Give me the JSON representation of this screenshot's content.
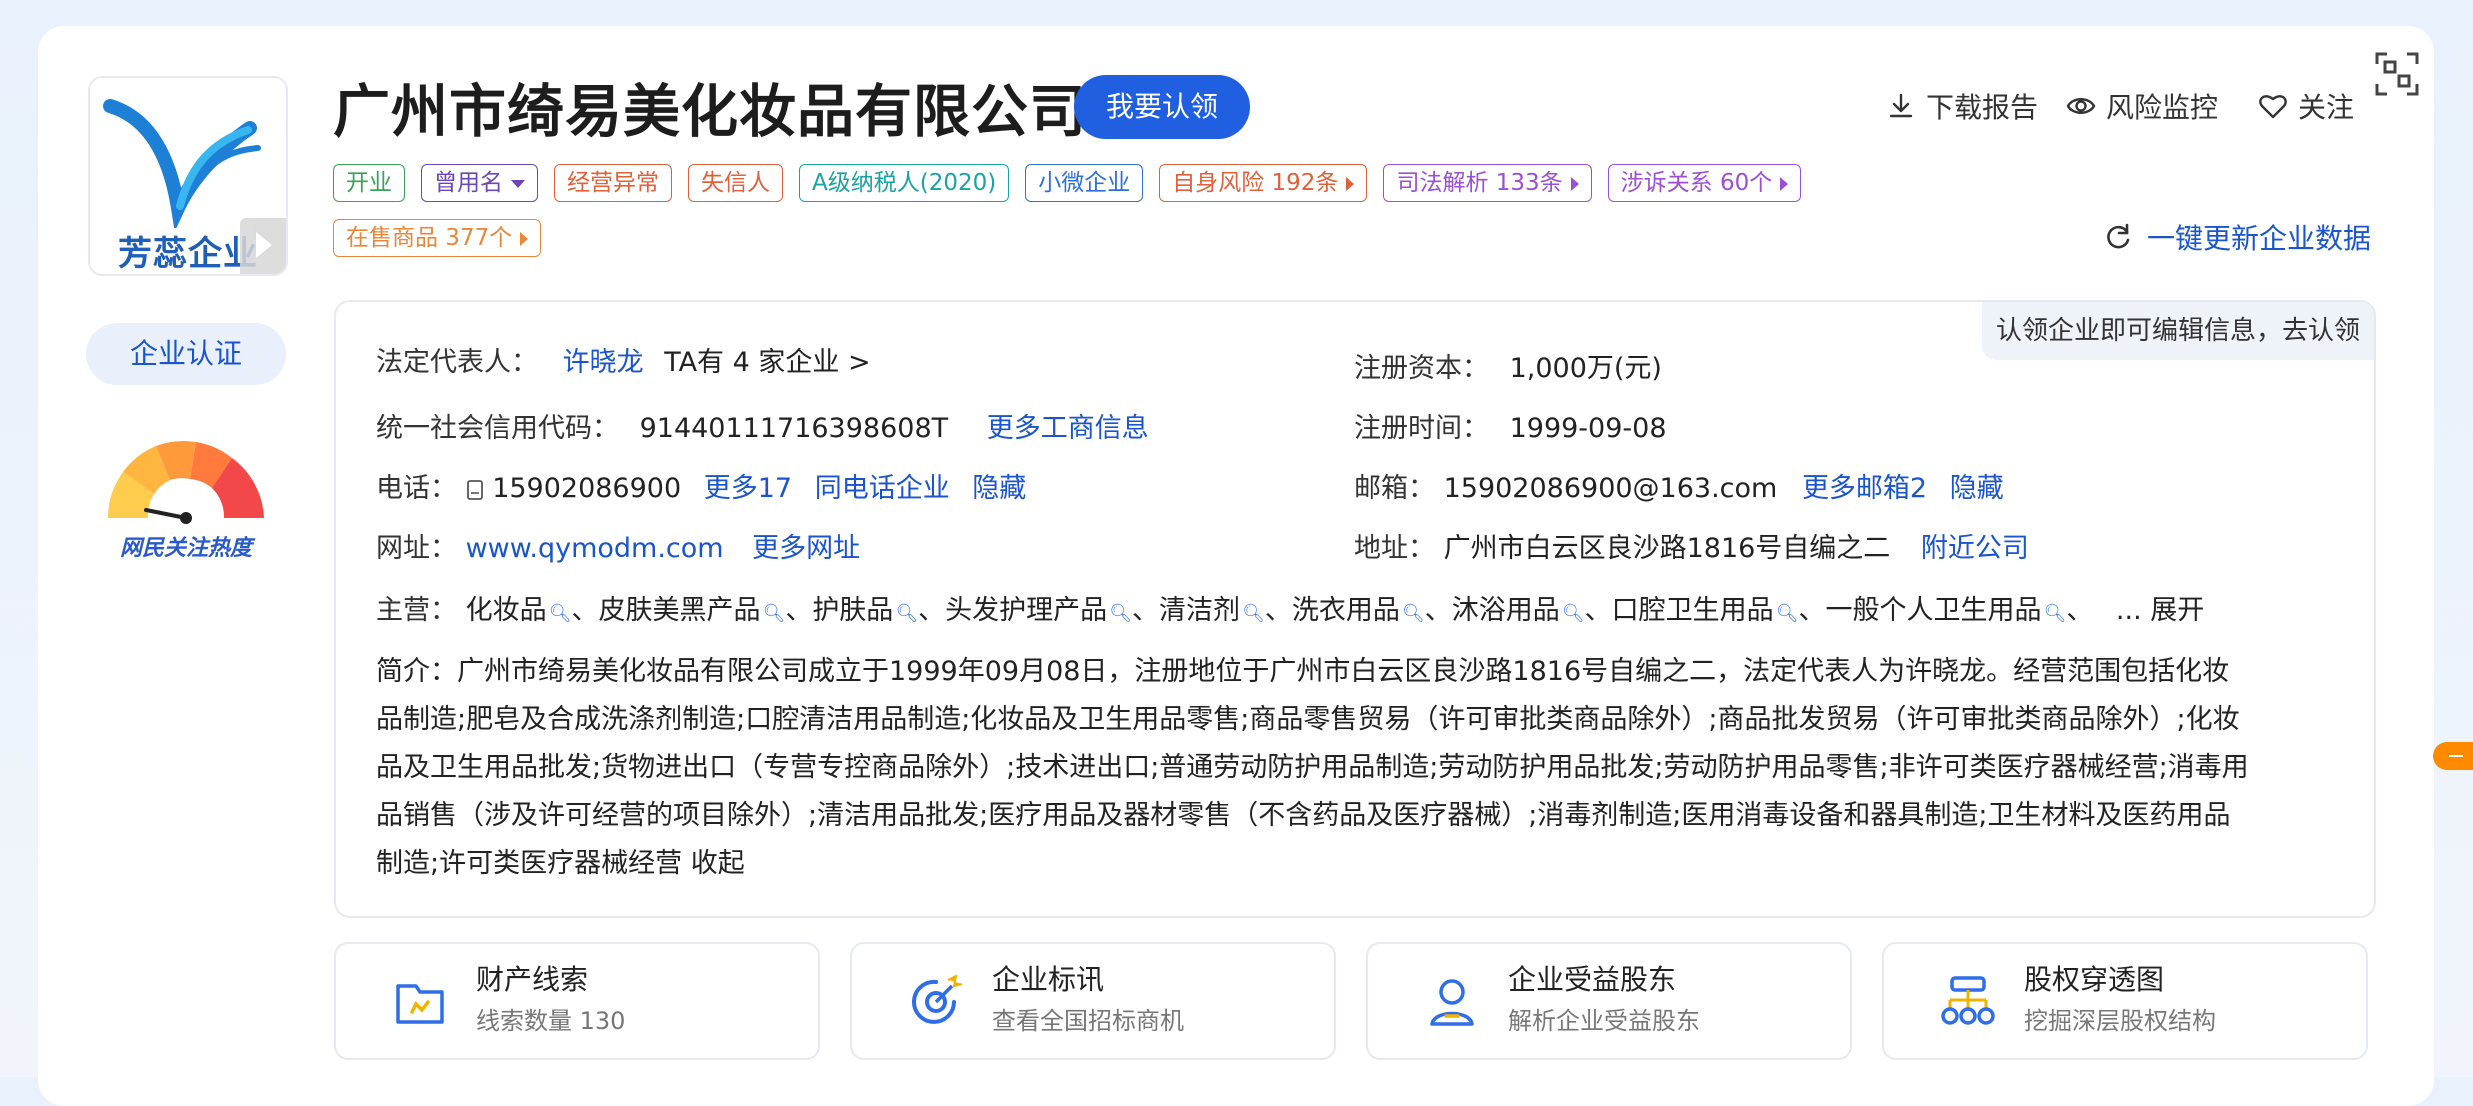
{
  "company": {
    "name": "广州市绮易美化妆品有限公司",
    "claim_button": "我要认领",
    "logo_text": "芳蕊企业"
  },
  "sidebar": {
    "cert_button": "企业认证",
    "heat_label": "网民关注热度"
  },
  "actions": {
    "download": "下载报告",
    "monitor": "风险监控",
    "follow": "关注",
    "update": "一键更新企业数据"
  },
  "tags": [
    {
      "label": "开业",
      "color": "#3aa35a"
    },
    {
      "label": "曾用名",
      "color": "#6a47b8",
      "dropdown": true
    },
    {
      "label": "经营异常",
      "color": "#e0603a"
    },
    {
      "label": "失信人",
      "color": "#e0603a"
    },
    {
      "label": "A级纳税人(2020)",
      "color": "#1aa3a3"
    },
    {
      "label": "小微企业",
      "color": "#2e6fd9"
    },
    {
      "label": "自身风险 192条",
      "color": "#e0603a",
      "arrow": true
    },
    {
      "label": "司法解析 133条",
      "color": "#9b4fd6",
      "arrow": true
    },
    {
      "label": "涉诉关系 60个",
      "color": "#9b4fd6",
      "arrow": true
    },
    {
      "label": "在售商品 377个",
      "color": "#e8873a",
      "arrow": true
    }
  ],
  "info": {
    "claim_hint": "认领企业即可编辑信息，去认领",
    "legal_rep_label": "法定代表人：",
    "legal_rep": "许晓龙",
    "legal_rep_companies": "TA有 4 家企业 >",
    "reg_capital_label": "注册资本：",
    "reg_capital": "1,000万(元)",
    "credit_code_label": "统一社会信用代码：",
    "credit_code": "91440111716398608T",
    "more_business": "更多工商信息",
    "reg_date_label": "注册时间：",
    "reg_date": "1999-09-08",
    "phone_label": "电话：",
    "phone": "15902086900",
    "more_phone": "更多17",
    "same_phone": "同电话企业",
    "hide": "隐藏",
    "email_label": "邮箱：",
    "email": "15902086900@163.com",
    "more_email": "更多邮箱2",
    "website_label": "网址：",
    "website": "www.qymodm.com",
    "more_website": "更多网址",
    "address_label": "地址：",
    "address": "广州市白云区良沙路1816号自编之二",
    "nearby": "附近公司",
    "main_label": "主营：",
    "main_items": [
      "化妆品",
      "皮肤美黑产品",
      "护肤品",
      "头发护理产品",
      "清洁剂",
      "洗衣用品",
      "沐浴用品",
      "口腔卫生用品",
      "一般个人卫生用品"
    ],
    "expand": "... 展开",
    "intro_label": "简介：",
    "intro_text": "广州市绮易美化妆品有限公司成立于1999年09月08日，注册地位于广州市白云区良沙路1816号自编之二，法定代表人为许晓龙。经营范围包括化妆品制造;肥皂及合成洗涤剂制造;口腔清洁用品制造;化妆品及卫生用品零售;商品零售贸易（许可审批类商品除外）;商品批发贸易（许可审批类商品除外）;化妆品及卫生用品批发;货物进出口（专营专控商品除外）;技术进出口;普通劳动防护用品制造;劳动防护用品批发;劳动防护用品零售;非许可类医疗器械经营;消毒用品销售（涉及许可经营的项目除外）;清洁用品批发;医疗用品及器材零售（不含药品及医疗器械）;消毒剂制造;医用消毒设备和器具制造;卫生材料及医药用品制造;许可类医疗器械经营",
    "collapse": "收起"
  },
  "cards": [
    {
      "title": "财产线索",
      "sub": "线索数量 130",
      "icon": "folder-icon"
    },
    {
      "title": "企业标讯",
      "sub": "查看全国招标商机",
      "icon": "target-icon"
    },
    {
      "title": "企业受益股东",
      "sub": "解析企业受益股东",
      "icon": "person-icon"
    },
    {
      "title": "股权穿透图",
      "sub": "挖掘深层股权结构",
      "icon": "org-chart-icon"
    }
  ]
}
